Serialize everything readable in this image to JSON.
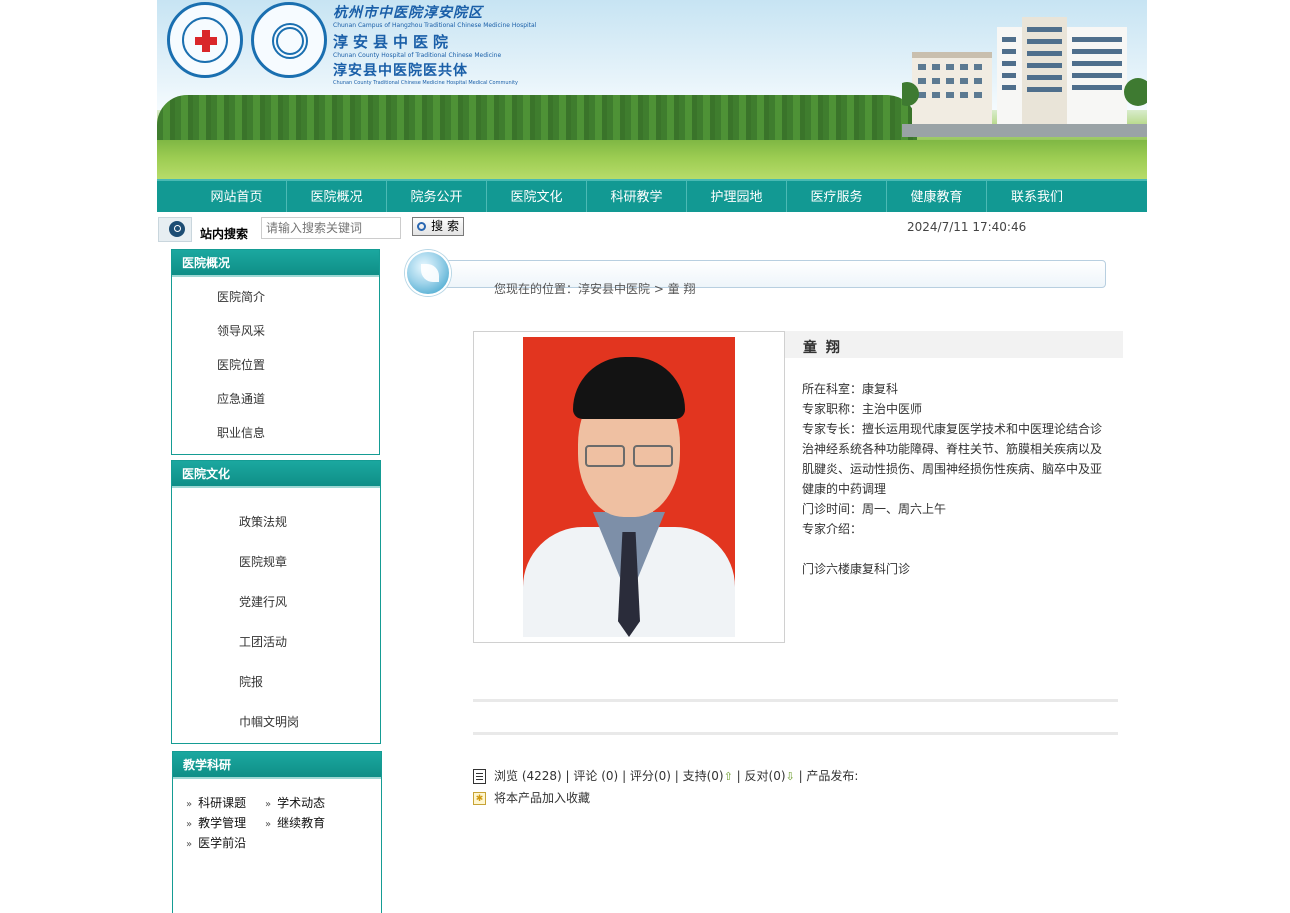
{
  "banner": {
    "line1": "杭州市中医院淳安院区",
    "line2": "Chunan Campus of Hangzhou Traditional Chinese Medicine Hospital",
    "line3": "淳安县中医院",
    "line4": "Chunan County Hospital of Traditional Chinese Medicine",
    "line5": "淳安县中医院医共体",
    "line6": "Chunan County Traditional Chinese Medicine Hospital Medical Community"
  },
  "nav": [
    "网站首页",
    "医院概况",
    "院务公开",
    "医院文化",
    "科研教学",
    "护理园地",
    "医疗服务",
    "健康教育",
    "联系我们"
  ],
  "search": {
    "label": "站内搜索",
    "placeholder": "请输入搜索关键词",
    "button": "搜 索",
    "datetime": "2024/7/11 17:40:46"
  },
  "sidebar": {
    "overview": {
      "title": "医院概况",
      "items": [
        "医院简介",
        "领导风采",
        "医院位置",
        "应急通道",
        "职业信息"
      ]
    },
    "culture": {
      "title": "医院文化",
      "items": [
        "政策法规",
        "医院规章",
        "党建行风",
        "工团活动",
        "院报",
        "巾帼文明岗"
      ]
    },
    "teaching": {
      "title": "教学科研",
      "items": [
        "科研课题",
        "学术动态",
        "教学管理",
        "继续教育",
        "医学前沿"
      ]
    }
  },
  "breadcrumb": "您现在的位置：淳安县中医院 > 童 翔",
  "doctor": {
    "name": "童 翔",
    "department": "所在科室：康复科",
    "title": "专家职称：主治中医师",
    "specialty": "专家专长：擅长运用现代康复医学技术和中医理论结合诊治神经系统各种功能障碍、脊柱关节、筋膜相关疾病以及肌腱炎、运动性损伤、周围神经损伤性疾病、脑卒中及亚健康的中药调理",
    "hours": "门诊时间：周一、周六上午",
    "intro_label": "专家介绍：",
    "location": "门诊六楼康复科门诊"
  },
  "stats": {
    "views": "浏览 (4228)",
    "comments": "评论 (0)",
    "rating": "评分(0)",
    "support": "支持(0)",
    "oppose": "反对(0)",
    "publish": "产品发布:",
    "favorite": "将本产品加入收藏"
  }
}
